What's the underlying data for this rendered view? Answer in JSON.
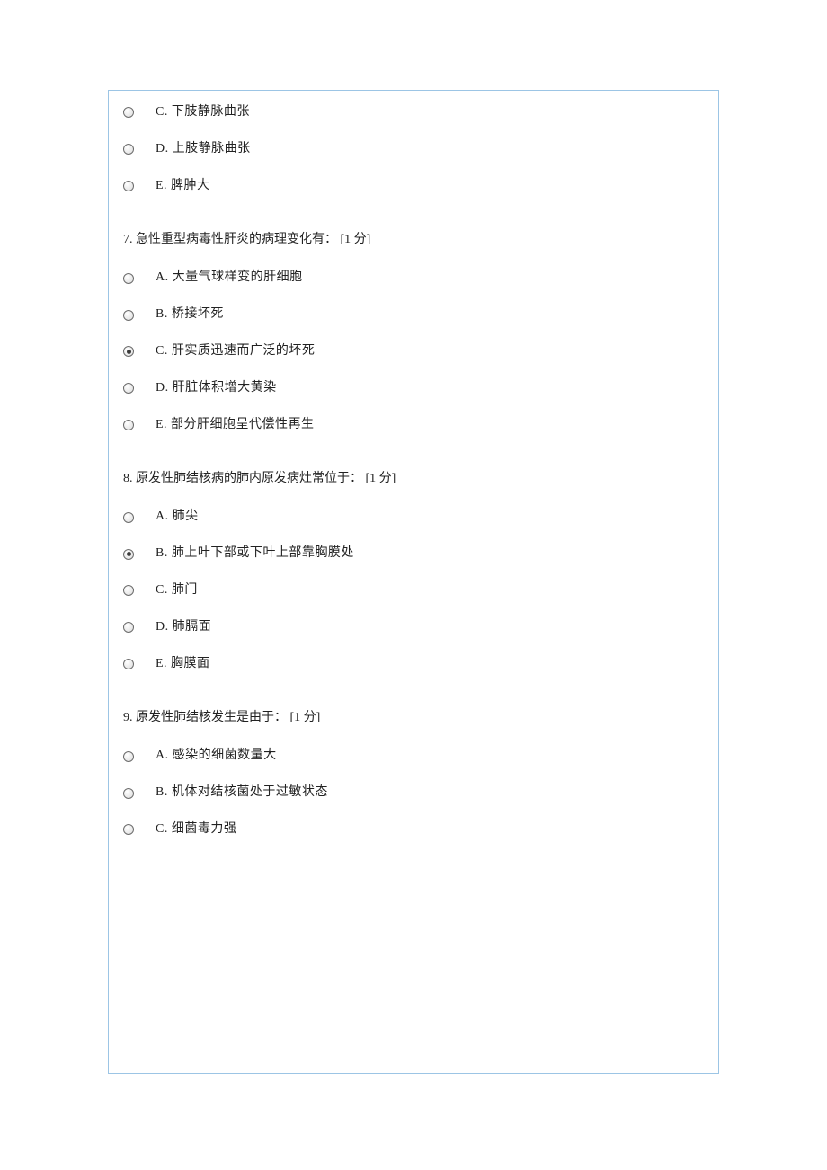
{
  "q6": {
    "options": [
      {
        "label": "C. 下肢静脉曲张",
        "selected": false
      },
      {
        "label": "D. 上肢静脉曲张",
        "selected": false
      },
      {
        "label": "E. 脾肿大",
        "selected": false
      }
    ]
  },
  "q7": {
    "text": "7.  急性重型病毒性肝炎的病理变化有：  [1 分]",
    "options": [
      {
        "label": "A. 大量气球样变的肝细胞",
        "selected": false
      },
      {
        "label": "B. 桥接坏死",
        "selected": false
      },
      {
        "label": "C. 肝实质迅速而广泛的坏死",
        "selected": true
      },
      {
        "label": "D. 肝脏体积增大黄染",
        "selected": false
      },
      {
        "label": "E. 部分肝细胞呈代偿性再生",
        "selected": false
      }
    ]
  },
  "q8": {
    "text": "8.  原发性肺结核病的肺内原发病灶常位于：  [1 分]",
    "options": [
      {
        "label": "A. 肺尖",
        "selected": false
      },
      {
        "label": "B. 肺上叶下部或下叶上部靠胸膜处",
        "selected": true
      },
      {
        "label": "C. 肺门",
        "selected": false
      },
      {
        "label": "D. 肺膈面",
        "selected": false
      },
      {
        "label": "E. 胸膜面",
        "selected": false
      }
    ]
  },
  "q9": {
    "text": "9.  原发性肺结核发生是由于：  [1 分]",
    "options": [
      {
        "label": "A. 感染的细菌数量大",
        "selected": false
      },
      {
        "label": "B. 机体对结核菌处于过敏状态",
        "selected": false
      },
      {
        "label": "C. 细菌毒力强",
        "selected": false
      }
    ]
  }
}
